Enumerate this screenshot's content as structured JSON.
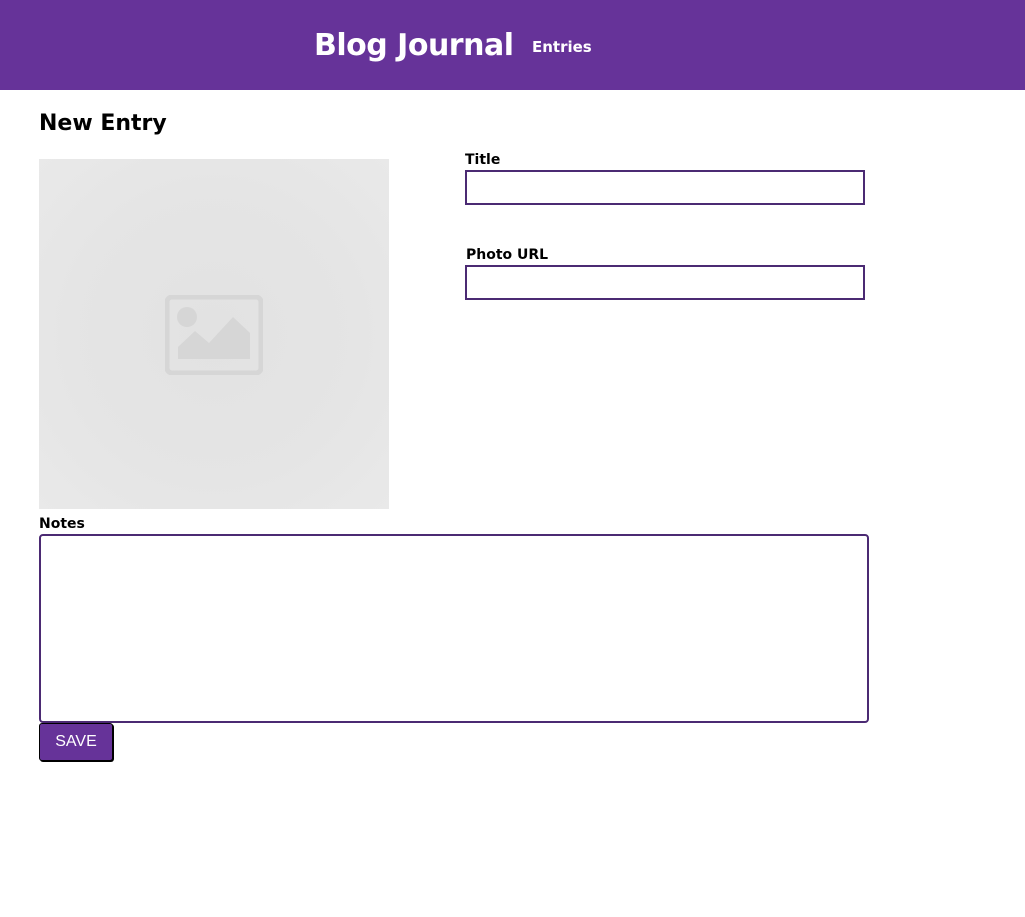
{
  "header": {
    "brand": "Blog Journal",
    "nav_entries": "Entries",
    "background_color": "#663399"
  },
  "page": {
    "title": "New Entry"
  },
  "form": {
    "photo_preview_icon": "image-placeholder-icon",
    "title_label": "Title",
    "title_value": "",
    "photo_url_label": "Photo URL",
    "photo_url_value": "",
    "notes_label": "Notes",
    "notes_value": "",
    "save_label": "SAVE",
    "input_border_color": "#4b2a73",
    "button_color": "#663399"
  }
}
